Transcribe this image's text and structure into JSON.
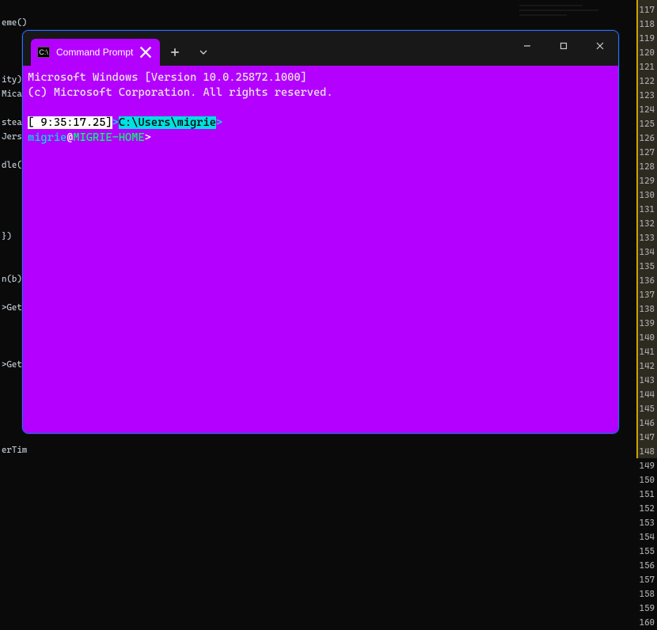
{
  "bg": {
    "left_fragments": [
      "",
      "eme());",
      "",
      "",
      "",
      "ity)",
      "Mica(",
      "",
      "stead",
      "Jers",
      "",
      "dle(",
      "",
      "",
      "",
      "",
      " })",
      "",
      "",
      "n(b);",
      "",
      ">GetH",
      "",
      "",
      "",
      ">GetH",
      "",
      "",
      "",
      "",
      "",
      "erTimer();"
    ],
    "line_numbers_start": 117,
    "line_numbers_end": 160
  },
  "window": {
    "tab_title": "Command Prompt",
    "newtab_label": "+",
    "chevron_label": "⌄",
    "min_label": "—",
    "max_label": "▢",
    "close_label": "✕"
  },
  "terminal": {
    "banner1": "Microsoft Windows [Version 10.0.25872.1000]",
    "banner2": "(c) Microsoft Corporation. All rights reserved.",
    "time_bracket": "[ 9:35:17.25]",
    "first_gt": ">",
    "path": "C:\\Users\\migrie",
    "path_gt": ">",
    "user": "migrie",
    "at": "@",
    "host": "MIGRIE-HOME",
    "second_gt": ">"
  }
}
